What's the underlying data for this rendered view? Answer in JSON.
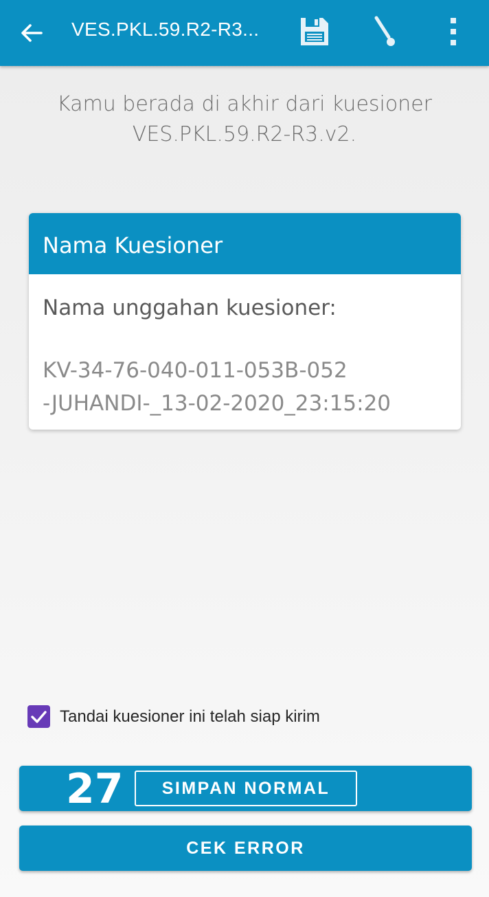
{
  "appbar": {
    "title": "VES.PKL.59.R2-R3...",
    "icons": [
      "back-arrow-icon",
      "save-icon",
      "brush-icon",
      "more-vert-icon"
    ]
  },
  "intro_text": "Kamu berada di akhir dari kuesioner VES.PKL.59.R2-R3.v2.",
  "card": {
    "header": "Nama Kuesioner",
    "label": "Nama unggahan kuesioner:",
    "value_line1": "KV-34-76-040-011-053B-052",
    "value_line2": "-JUHANDI-_13-02-2020_23:15:20"
  },
  "checkbox": {
    "label": "Tandai kuesioner ini telah siap kirim",
    "checked": true
  },
  "buttons": {
    "simpan_badge": "27",
    "simpan_label": "SIMPAN NORMAL",
    "cek_label": "CEK ERROR"
  },
  "colors": {
    "primary": "#0b90c2",
    "checkbox": "#673ab7"
  }
}
